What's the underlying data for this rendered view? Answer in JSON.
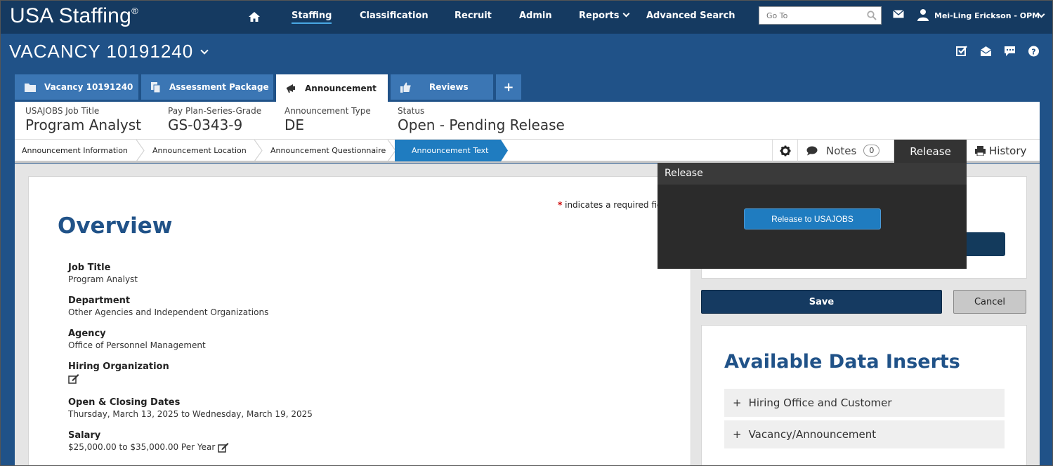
{
  "app": {
    "brand": "USA Staffing",
    "brand_mark": "®"
  },
  "nav": {
    "items": [
      "Staffing",
      "Classification",
      "Recruit",
      "Admin",
      "Reports",
      "Advanced Search"
    ],
    "active": "Staffing",
    "goto_placeholder": "Go To",
    "user": "Mei-Ling Erickson - OPM"
  },
  "vacancy": {
    "title": "VACANCY 10191240"
  },
  "tabs": [
    {
      "label": "Vacancy 10191240",
      "icon": "folder-icon"
    },
    {
      "label": "Assessment Package",
      "icon": "documents-icon"
    },
    {
      "label": "Announcement",
      "icon": "megaphone-icon",
      "active": true
    },
    {
      "label": "Reviews",
      "icon": "thumbs-up-icon"
    },
    {
      "label": "+",
      "icon": "plus-icon"
    }
  ],
  "info": {
    "job_title_label": "USAJOBS Job Title",
    "job_title": "Program Analyst",
    "pps_label": "Pay Plan-Series-Grade",
    "pps": "GS-0343-9",
    "type_label": "Announcement Type",
    "type": "DE",
    "status_label": "Status",
    "status": "Open - Pending Release"
  },
  "breadcrumbs": [
    "Announcement Information",
    "Announcement Location",
    "Announcement Questionnaire",
    "Announcement Text"
  ],
  "toolbar": {
    "notes_label": "Notes",
    "notes_count": "0",
    "release_label": "Release",
    "history_label": "History"
  },
  "form": {
    "required_note": "indicates a required fie",
    "required_mark": "*",
    "heading": "Overview",
    "fields": [
      {
        "label": "Job Title",
        "value": "Program Analyst"
      },
      {
        "label": "Department",
        "value": "Other Agencies and Independent Organizations"
      },
      {
        "label": "Agency",
        "value": "Office of Personnel Management"
      },
      {
        "label": "Hiring Organization",
        "value": ""
      },
      {
        "label": "Open & Closing Dates",
        "value": "Thursday, March 13, 2025 to Wednesday, March 19, 2025"
      },
      {
        "label": "Salary",
        "value": "$25,000.00 to $35,000.00 Per Year"
      }
    ]
  },
  "actions": {
    "save": "Save",
    "cancel": "Cancel"
  },
  "inserts": {
    "title": "Available Data Inserts",
    "items": [
      "Hiring Office and Customer",
      "Vacancy/Announcement"
    ]
  },
  "popup": {
    "title": "Release",
    "button": "Release to USAJOBS"
  },
  "colors": {
    "nav_bg": "#153a61",
    "page_bg": "#205288",
    "accent": "#1f7cc0",
    "heading": "#205288"
  }
}
